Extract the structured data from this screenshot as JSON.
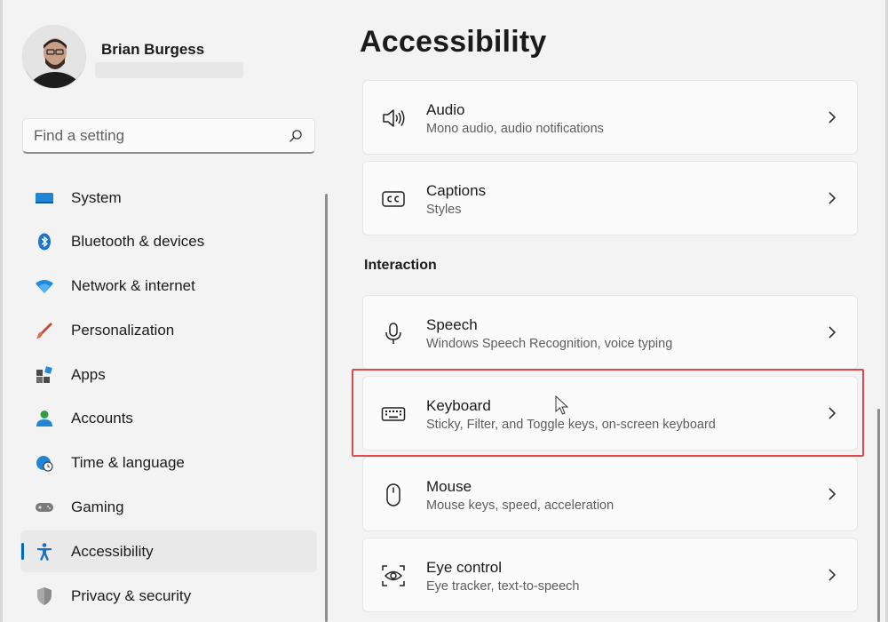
{
  "profile": {
    "name": "Brian Burgess"
  },
  "search": {
    "placeholder": "Find a setting"
  },
  "nav": {
    "items": [
      {
        "label": "System",
        "icon": "system-icon"
      },
      {
        "label": "Bluetooth & devices",
        "icon": "bluetooth-icon"
      },
      {
        "label": "Network & internet",
        "icon": "wifi-icon"
      },
      {
        "label": "Personalization",
        "icon": "brush-icon"
      },
      {
        "label": "Apps",
        "icon": "apps-icon"
      },
      {
        "label": "Accounts",
        "icon": "person-icon"
      },
      {
        "label": "Time & language",
        "icon": "clock-globe-icon"
      },
      {
        "label": "Gaming",
        "icon": "gamepad-icon"
      },
      {
        "label": "Accessibility",
        "icon": "accessibility-icon",
        "active": true
      },
      {
        "label": "Privacy & security",
        "icon": "shield-icon"
      }
    ]
  },
  "main": {
    "title": "Accessibility",
    "section_interaction": "Interaction",
    "cards": {
      "audio": {
        "title": "Audio",
        "subtitle": "Mono audio, audio notifications"
      },
      "captions": {
        "title": "Captions",
        "subtitle": "Styles"
      },
      "speech": {
        "title": "Speech",
        "subtitle": "Windows Speech Recognition, voice typing"
      },
      "keyboard": {
        "title": "Keyboard",
        "subtitle": "Sticky, Filter, and Toggle keys, on-screen keyboard",
        "highlighted": true
      },
      "mouse": {
        "title": "Mouse",
        "subtitle": "Mouse keys, speed, acceleration"
      },
      "eye_control": {
        "title": "Eye control",
        "subtitle": "Eye tracker, text-to-speech"
      }
    }
  },
  "colors": {
    "accent": "#0067c0",
    "highlight_border": "#e0494a",
    "background": "#f3f3f3",
    "card": "#fbfbfb"
  }
}
